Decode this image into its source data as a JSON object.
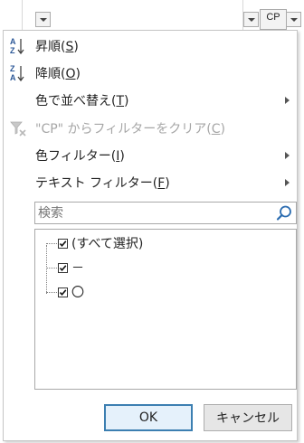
{
  "column_header": {
    "label": "CP"
  },
  "menu": {
    "sort_asc": {
      "text": "昇順(",
      "key": "S",
      "close": ")"
    },
    "sort_desc": {
      "text": "降順(",
      "key": "O",
      "close": ")"
    },
    "sort_by_color": {
      "text": "色で並べ替え(",
      "key": "T",
      "close": ")"
    },
    "clear_filter": {
      "text": "\"CP\" からフィルターをクリア(",
      "key": "C",
      "close": ")"
    },
    "color_filter": {
      "text": "色フィルター(",
      "key": "I",
      "close": ")"
    },
    "text_filter": {
      "text": "テキスト フィルター(",
      "key": "F",
      "close": ")"
    }
  },
  "search": {
    "placeholder": "検索"
  },
  "values": [
    {
      "label": "(すべて選択)",
      "checked": true
    },
    {
      "label": "－",
      "checked": true
    },
    {
      "label": "〇",
      "checked": true
    }
  ],
  "buttons": {
    "ok": "OK",
    "cancel": "キャンセル"
  }
}
